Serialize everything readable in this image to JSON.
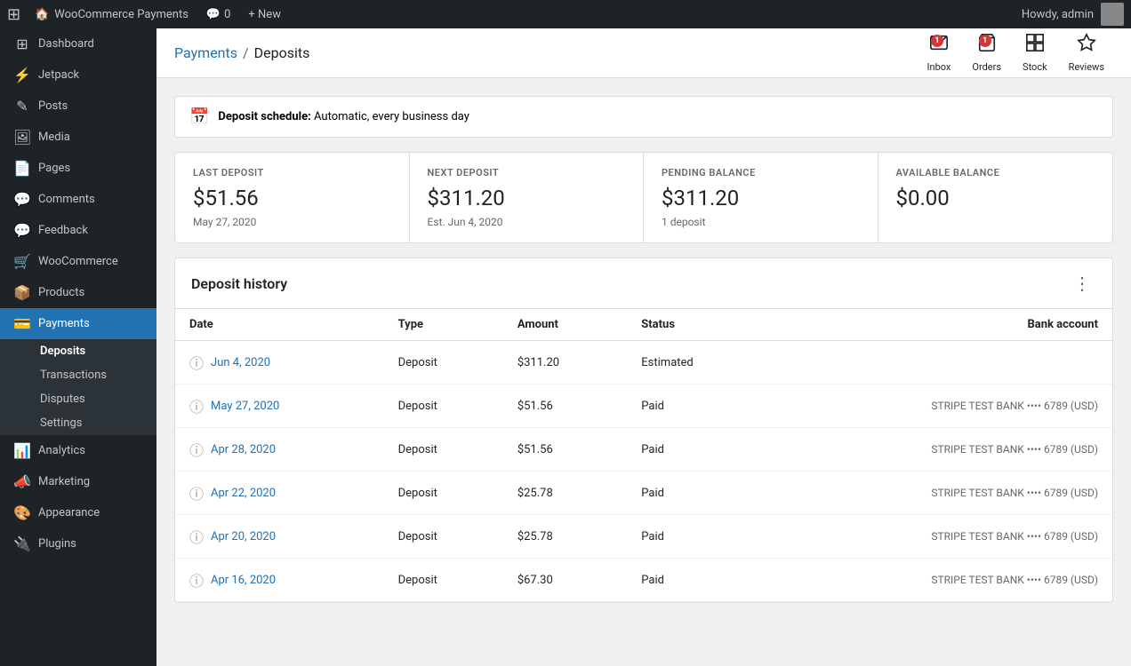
{
  "adminBar": {
    "logo": "⊞",
    "site_name": "WooCommerce Payments",
    "comments_label": "Comments",
    "comments_count": "0",
    "new_label": "+ New",
    "howdy": "Howdy, admin"
  },
  "topIcons": [
    {
      "id": "inbox",
      "label": "Inbox",
      "badge": "1"
    },
    {
      "id": "orders",
      "label": "Orders",
      "badge": "1"
    },
    {
      "id": "stock",
      "label": "Stock",
      "badge": null
    },
    {
      "id": "reviews",
      "label": "Reviews",
      "badge": null
    }
  ],
  "breadcrumb": {
    "parent_label": "Payments",
    "separator": "/",
    "current": "Deposits"
  },
  "depositSchedule": {
    "label": "Deposit schedule:",
    "value": "Automatic, every business day"
  },
  "stats": [
    {
      "label": "LAST DEPOSIT",
      "value": "$51.56",
      "sub": "May 27, 2020"
    },
    {
      "label": "NEXT DEPOSIT",
      "value": "$311.20",
      "sub": "Est. Jun 4, 2020"
    },
    {
      "label": "PENDING BALANCE",
      "value": "$311.20",
      "sub": "1 deposit"
    },
    {
      "label": "AVAILABLE BALANCE",
      "value": "$0.00",
      "sub": ""
    }
  ],
  "depositHistory": {
    "title": "Deposit history",
    "columns": [
      "Date",
      "Type",
      "Amount",
      "Status",
      "Bank account"
    ],
    "rows": [
      {
        "date": "Jun 4, 2020",
        "type": "Deposit",
        "amount": "$311.20",
        "status": "Estimated",
        "bank": ""
      },
      {
        "date": "May 27, 2020",
        "type": "Deposit",
        "amount": "$51.56",
        "status": "Paid",
        "bank": "STRIPE TEST BANK •••• 6789 (USD)"
      },
      {
        "date": "Apr 28, 2020",
        "type": "Deposit",
        "amount": "$51.56",
        "status": "Paid",
        "bank": "STRIPE TEST BANK •••• 6789 (USD)"
      },
      {
        "date": "Apr 22, 2020",
        "type": "Deposit",
        "amount": "$25.78",
        "status": "Paid",
        "bank": "STRIPE TEST BANK •••• 6789 (USD)"
      },
      {
        "date": "Apr 20, 2020",
        "type": "Deposit",
        "amount": "$25.78",
        "status": "Paid",
        "bank": "STRIPE TEST BANK •••• 6789 (USD)"
      },
      {
        "date": "Apr 16, 2020",
        "type": "Deposit",
        "amount": "$67.30",
        "status": "Paid",
        "bank": "STRIPE TEST BANK •••• 6789 (USD)"
      }
    ]
  },
  "sidebar": {
    "items": [
      {
        "id": "dashboard",
        "icon": "⊞",
        "label": "Dashboard"
      },
      {
        "id": "jetpack",
        "icon": "⚡",
        "label": "Jetpack"
      },
      {
        "id": "posts",
        "icon": "✎",
        "label": "Posts"
      },
      {
        "id": "media",
        "icon": "🖼",
        "label": "Media"
      },
      {
        "id": "pages",
        "icon": "📄",
        "label": "Pages"
      },
      {
        "id": "comments",
        "icon": "💬",
        "label": "Comments"
      },
      {
        "id": "feedback",
        "icon": "💬",
        "label": "Feedback"
      },
      {
        "id": "woocommerce",
        "icon": "🛒",
        "label": "WooCommerce"
      },
      {
        "id": "products",
        "icon": "📦",
        "label": "Products"
      },
      {
        "id": "payments",
        "icon": "💳",
        "label": "Payments",
        "active": true
      }
    ],
    "submenu": [
      {
        "id": "deposits",
        "label": "Deposits",
        "active": true
      },
      {
        "id": "transactions",
        "label": "Transactions"
      },
      {
        "id": "disputes",
        "label": "Disputes"
      },
      {
        "id": "settings",
        "label": "Settings"
      }
    ],
    "bottom_items": [
      {
        "id": "analytics",
        "icon": "📊",
        "label": "Analytics"
      },
      {
        "id": "marketing",
        "icon": "📣",
        "label": "Marketing"
      },
      {
        "id": "appearance",
        "icon": "🎨",
        "label": "Appearance"
      },
      {
        "id": "plugins",
        "icon": "🔌",
        "label": "Plugins"
      }
    ]
  }
}
